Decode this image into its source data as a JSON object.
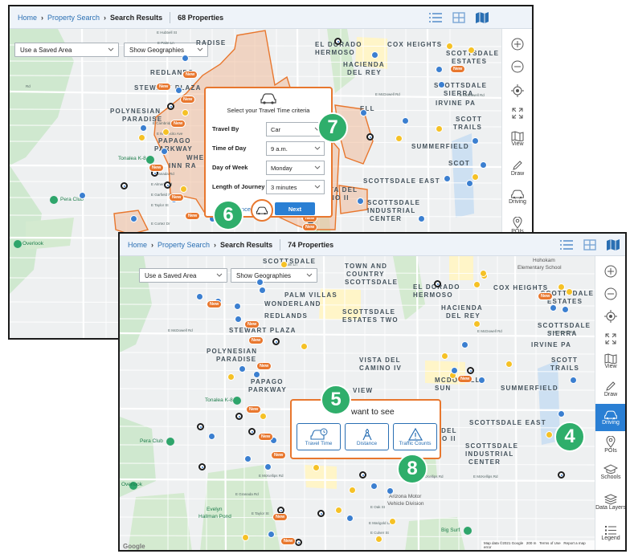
{
  "back_window": {
    "breadcrumb": {
      "home": "Home",
      "search": "Property Search",
      "current": "Search Results",
      "count": "68 Properties"
    },
    "controls": {
      "saved_area": "Use a Saved Area",
      "geographies": "Show Geographies"
    },
    "places": {
      "radisee": "RADISE",
      "redlands": "REDLANDS",
      "stewart": "STEWART PLAZA",
      "polynesian": "POLYNESIAN",
      "paradise": "PARADISE",
      "papago": "PAPAGO",
      "parkway": "PARKWAY",
      "wheel": "WHEEL",
      "inn": "INN RA",
      "eldorado": "EL DORADO",
      "hermoso": "HERMOSO",
      "coxheights": "COX HEIGHTS",
      "hacienda": "HACIENDA",
      "delrey": "DEL REY",
      "scottsdale": "SCOTTSDALE",
      "sierra": "SIERRA",
      "irvine": "IRVINE PA",
      "scott2": "SCOTT",
      "trails": "TRAILS",
      "summerfield": "SUMMERFIELD",
      "scottsdaleeast": "SCOTTSDALE EAST",
      "tadel": "TA DEL",
      "noii": "NO II",
      "scottsdale2": "SCOTTSDALE",
      "industrial": "INDUSTRIAL",
      "center": "CENTER",
      "scott_estates": "SCOTTSDALE",
      "estates": "ESTATES",
      "ell": "ELL",
      "ivd": "T",
      "vscot": "SCOT"
    },
    "pois": {
      "tonalea": "Tonalea K-8",
      "peraclub": "Pera Club",
      "overlook": "Overlook"
    },
    "streets": {
      "mcdowell": "E McDowell Rd",
      "mcdowell2": "E McDowell Rd",
      "rd": "Rd",
      "hubbell": "E Hubbell St",
      "palm": "E Palm Ln",
      "cambridge": "E Cambridge Ave",
      "oak": "E Oak St",
      "monte": "E Montecito Ave",
      "sheridan": "E Sheridan St",
      "coronado": "E Coronado Rd",
      "lewis": "E Lewis Ave",
      "mcdowell_road": "E McDowell Rd",
      "granada": "E Granada Rd",
      "almeria": "E Almeria Rd",
      "garfield": "E Garfield St",
      "taylor": "E Taylor St",
      "cortez": "E Cortez Dr",
      "hayden": "N Hayden Rd",
      "college": "N College Ave",
      "70th": "N 70th St",
      "66th": "N 66th St"
    },
    "travel_panel": {
      "title": "Select your Travel Time criteria",
      "rows": [
        {
          "label": "Travel By",
          "value": "Car"
        },
        {
          "label": "Time of Day",
          "value": "9 a.m."
        },
        {
          "label": "Day of Week",
          "value": "Monday"
        },
        {
          "label": "Length of Journey",
          "value": "3 minutes"
        }
      ],
      "cancel": "Cancel",
      "next": "Next"
    },
    "rail": [
      {
        "icon": "zoom-in-icon",
        "label": ""
      },
      {
        "icon": "zoom-out-icon",
        "label": ""
      },
      {
        "icon": "locate-icon",
        "label": ""
      },
      {
        "icon": "fullscreen-icon",
        "label": ""
      },
      {
        "icon": "map-view-icon",
        "label": "View"
      },
      {
        "icon": "pencil-icon",
        "label": "Draw"
      },
      {
        "icon": "car-icon",
        "label": "Driving"
      },
      {
        "icon": "poi-icon",
        "label": "POIs"
      }
    ],
    "new_tag": "New",
    "badges": {
      "six": "6",
      "seven": "7"
    }
  },
  "front_window": {
    "breadcrumb": {
      "home": "Home",
      "search": "Property Search",
      "current": "Search Results",
      "count": "74 Properties"
    },
    "controls": {
      "saved_area": "Use a Saved Area",
      "geographies": "Show Geographies"
    },
    "places": {
      "town": "TOWN AND",
      "country": "COUNTRY",
      "scottsdale_t": "SCOTTSDALE",
      "scott_top": "SCOTTSDALE",
      "palm": "PALM VILLAS",
      "wonderland": "WONDERLAND",
      "redlands": "REDLANDS",
      "scottsdale_estates": "SCOTTSDALE",
      "estates_two": "ESTATES TWO",
      "stewart": "STEWART PLAZA",
      "polynesian": "POLYNESIAN",
      "paradise": "PARADISE",
      "papago": "PAPAGO",
      "parkway": "PARKWAY",
      "eldorado": "EL DORADO",
      "hermoso": "HERMOSO",
      "cox": "COX HEIGHTS",
      "hacienda": "HACIENDA",
      "delrey": "DEL REY",
      "scottsdale_r": "SCOTTSDALE",
      "estates_r": "ESTATES",
      "scottsdale_s": "SCOTTSDALE",
      "sierra": "SIERRA",
      "irvine": "IRVINE PA",
      "vista": "VISTA DEL",
      "camino": "CAMINO IV",
      "mcdowell": "MCDOWELL",
      "sun": "SUN",
      "scott_trails": "SCOTT",
      "trails": "TRAILS",
      "summerfield": "SUMMERFIELD",
      "view": "VIEW",
      "sdeast": "SCOTTSDALE EAST",
      "tadel": "A DEL",
      "noii": "NO II",
      "sdi": "SCOTTSDALE",
      "ind": "INDUSTRIAL",
      "center": "CENTER"
    },
    "pois": {
      "tonalea": "Tonalea K-8",
      "pera": "Pera Club",
      "overlook": "Overlook",
      "evelyn": "Evelyn",
      "hallman": "Hallman Pond",
      "arizona": "Arizona Motor",
      "vehicle": "Vehicle Division",
      "bigsurf": "Big Surf",
      "hohokam": "Hohokam",
      "elementary": "Elementary School"
    },
    "streets": {
      "mcdowell": "E McDowell Rd",
      "mcdowell2": "E McDowell Rd",
      "mcdowell3": "E McDowell Rd",
      "mckellips": "E McKellips Rd",
      "mckellips2": "E McKellips Rd",
      "mckellips3": "E McKellips Rd",
      "hayden": "N Hayden Rd",
      "college": "N College Ave",
      "granada": "E Granada Rd",
      "taylor": "E Taylor St",
      "marigold": "E Marigold Ln",
      "palm": "E Palm Ln",
      "oak": "E Oak St",
      "culver": "E Culver St",
      "mcclintock": "N McClintock Dr",
      "miller": "N Miller Rd"
    },
    "want_panel": {
      "title": "want to see",
      "options": [
        {
          "icon": "car-clock-icon",
          "label": "Travel Time"
        },
        {
          "icon": "compass-icon",
          "label": "Distance"
        },
        {
          "icon": "warning-icon",
          "label": "Traffic Counts"
        }
      ]
    },
    "rail": [
      {
        "icon": "zoom-in-icon",
        "label": ""
      },
      {
        "icon": "zoom-out-icon",
        "label": ""
      },
      {
        "icon": "locate-icon",
        "label": ""
      },
      {
        "icon": "fullscreen-icon",
        "label": ""
      },
      {
        "icon": "map-view-icon",
        "label": "View"
      },
      {
        "icon": "pencil-icon",
        "label": "Draw"
      },
      {
        "icon": "car-icon",
        "label": "Driving"
      },
      {
        "icon": "poi-icon",
        "label": "POIs"
      },
      {
        "icon": "school-icon",
        "label": "Schools"
      },
      {
        "icon": "layers-icon",
        "label": "Data Layers"
      },
      {
        "icon": "legend-icon",
        "label": "Legend"
      }
    ],
    "footer": {
      "mapdata": "Map data ©2021 Google",
      "scale": "200 m",
      "terms": "Terms of Use",
      "report": "Report a map error"
    },
    "google": "Google",
    "new_tag": "New",
    "badges": {
      "four": "4",
      "five": "5",
      "eight": "8"
    }
  },
  "colors": {
    "accent": "#e8772e",
    "brand_blue": "#2a7fd4",
    "badge_green": "#2fae6b"
  }
}
